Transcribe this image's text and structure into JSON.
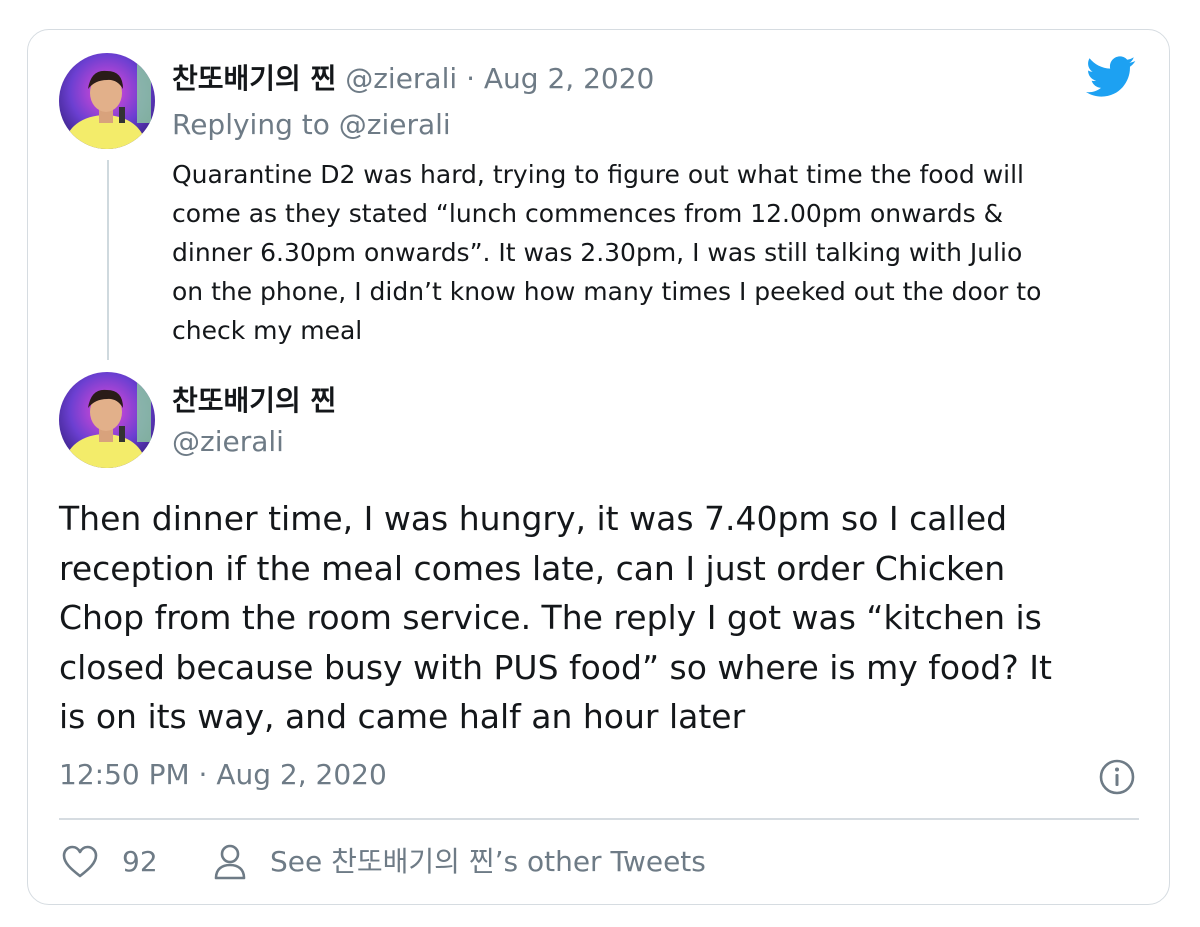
{
  "tweet_parent": {
    "display_name": "찬또배기의 찐",
    "handle": "@zierali",
    "separator": "·",
    "date": "Aug 2, 2020",
    "replying_to_prefix": "Replying to",
    "replying_to_handle": "@zierali",
    "text_lines": [
      "Quarantine D2 was hard, trying to figure out what time the food will",
      "come as they stated “lunch commences from 12.00pm onwards &",
      "dinner 6.30pm onwards”. It was 2.30pm, I was still talking with Julio",
      "on the phone, I didn’t know how many times I peeked out the door to",
      "check my meal"
    ]
  },
  "tweet_main": {
    "display_name": "찬또배기의 찐",
    "handle": "@zierali",
    "text_lines": [
      "Then dinner time, I was hungry, it was 7.40pm so I called",
      "reception if the meal comes late, can I just order Chicken",
      "Chop from the room service. The reply I got was “kitchen is",
      "closed because busy with PUS food” so where is my food? It",
      "is on its way, and came half an hour later"
    ],
    "timestamp": "12:50 PM · Aug 2, 2020",
    "like_count": "92",
    "see_other_tweets": "See 찬또배기의 찐’s other Tweets"
  },
  "icons": {
    "brand": "twitter-bird-icon",
    "info": "info-icon",
    "like": "heart-icon",
    "profile": "person-icon"
  },
  "colors": {
    "twitter_blue": "#1da1f2",
    "text_primary": "#14171a",
    "text_muted": "#6e7b86",
    "border": "#d6dce1"
  }
}
